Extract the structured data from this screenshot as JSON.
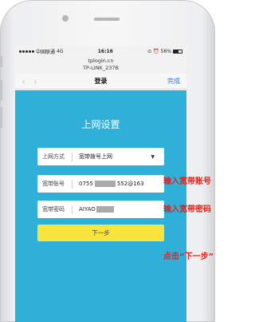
{
  "status": {
    "carrier": "中国联通",
    "network": "4G",
    "time": "16:16",
    "battery": "56%"
  },
  "browser": {
    "host": "tplogin.cn",
    "ssid": "TP-LINK_237B"
  },
  "nav": {
    "title": "登录",
    "done": "完成",
    "back": "‹",
    "forward": "›"
  },
  "page": {
    "heading": "上网设置",
    "mode_label": "上网方式",
    "mode_value": "宽带拨号上网",
    "mode_caret": "▼",
    "account_label": "宽带账号",
    "account_prefix": "0755",
    "account_suffix": "552@163",
    "password_label": "宽带密码",
    "password_value": "AIYAO",
    "next_button": "下一步"
  },
  "annotations": {
    "account": "输入宽带账号",
    "password": "输入宽带密码",
    "next": "点击“下一步”"
  },
  "colors": {
    "content_bg": "#2fb0d8",
    "button": "#f8e43c",
    "annotation": "#e8211a",
    "link": "#1a7cf2"
  }
}
